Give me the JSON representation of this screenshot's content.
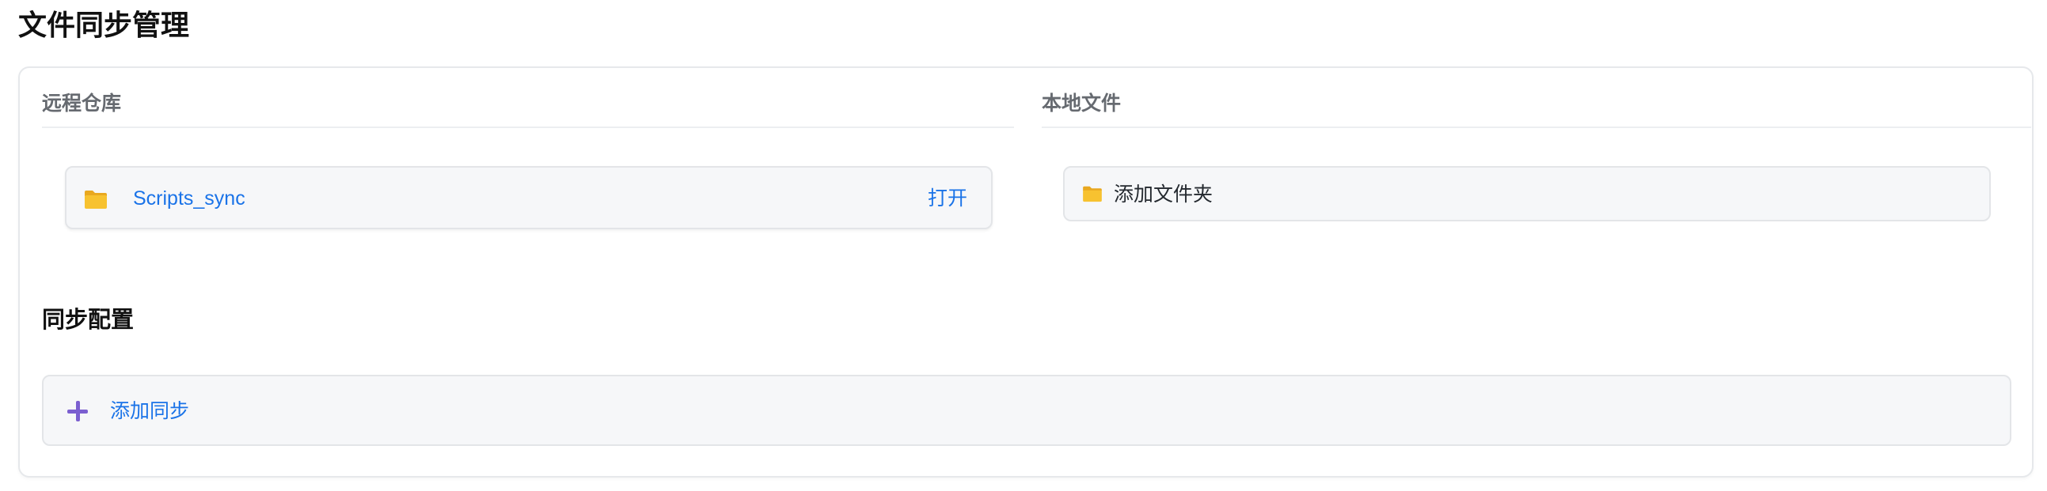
{
  "page": {
    "title": "文件同步管理"
  },
  "remote_repo": {
    "heading": "远程仓库",
    "items": [
      {
        "name": "Scripts_sync",
        "icon": "folder-icon",
        "action_label": "打开"
      }
    ]
  },
  "local_files": {
    "heading": "本地文件",
    "add_folder_label": "添加文件夹",
    "icon": "folder-icon"
  },
  "sync_config": {
    "heading": "同步配置",
    "add_sync_label": "添加同步",
    "icon": "plus-icon"
  },
  "colors": {
    "link": "#1a73e8",
    "folder": "#f7c230",
    "plus_accent": "#7b5fd0",
    "item_bg": "#f6f7f9"
  }
}
